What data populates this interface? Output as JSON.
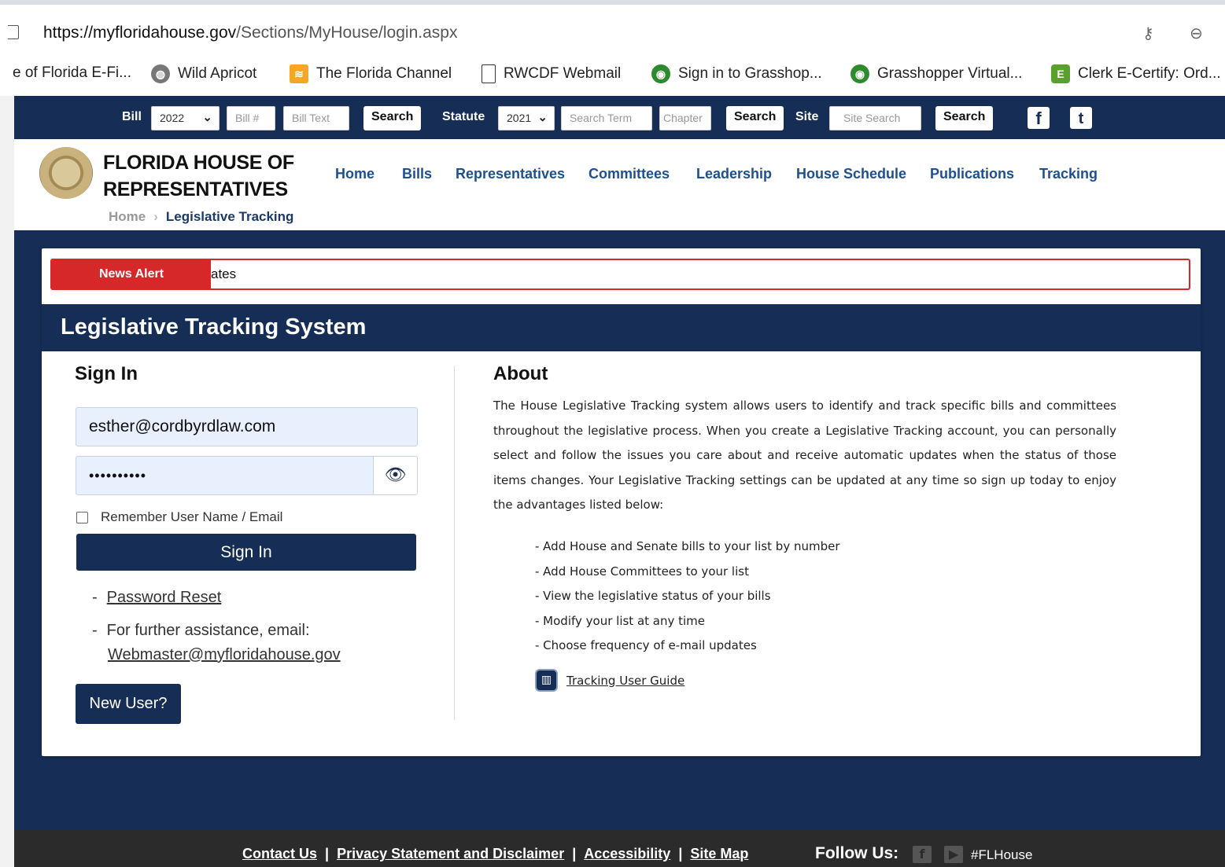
{
  "browser": {
    "url_host": "https://myfloridahouse.gov",
    "url_path": "/Sections/MyHouse/login.aspx",
    "bookmarks": [
      {
        "label": "e of Florida E-Fi...",
        "icon": "none"
      },
      {
        "label": "Wild Apricot",
        "icon": "globe-icon"
      },
      {
        "label": "The Florida Channel",
        "icon": "florida-channel-icon"
      },
      {
        "label": "RWCDF Webmail",
        "icon": "document-icon"
      },
      {
        "label": "Sign in to Grasshop...",
        "icon": "grasshopper-icon"
      },
      {
        "label": "Grasshopper Virtual...",
        "icon": "grasshopper-icon"
      },
      {
        "label": "Clerk E-Certify: Ord...",
        "icon": "clerk-icon"
      }
    ]
  },
  "searchbar": {
    "bill_label": "Bill",
    "bill_year": "2022",
    "bill_num_placeholder": "Bill #",
    "bill_text_placeholder": "Bill Text",
    "search1": "Search",
    "statute_label": "Statute",
    "statute_year": "2021",
    "search_term_placeholder": "Search Term",
    "chapter_placeholder": "Chapter",
    "search2": "Search",
    "site_label": "Site",
    "site_search_placeholder": "Site Search",
    "search3": "Search",
    "facebook": "f",
    "twitter": "t"
  },
  "header": {
    "brand_line1": "FLORIDA HOUSE OF",
    "brand_line2": "REPRESENTATIVES",
    "nav": [
      "Home",
      "Bills",
      "Representatives",
      "Committees",
      "Leadership",
      "House Schedule",
      "Publications",
      "Tracking"
    ],
    "breadcrumb_home": "Home",
    "breadcrumb_sep": "›",
    "breadcrumb_current": "Legislative Tracking"
  },
  "alert": {
    "tag": "News Alert",
    "message": "ates"
  },
  "panel": {
    "title": "Legislative Tracking System"
  },
  "signin": {
    "heading": "Sign In",
    "email_value": "esther@cordbyrdlaw.com",
    "password_value": "••••••••••",
    "remember_label": "Remember User Name / Email",
    "button": "Sign In",
    "password_reset": "Password Reset",
    "assist_text": "For further assistance, email:",
    "assist_email": "Webmaster@myfloridahouse.gov",
    "new_user": "New User?"
  },
  "about": {
    "heading": "About",
    "paragraph": "The House Legislative Tracking system allows users to identify and track specific bills and committees throughout the legislative process. When you create a Legislative Tracking account, you can personally select and follow the issues you care about and receive automatic updates when the status of those items changes. Your Legislative Tracking settings can be updated at any time so sign up today to enjoy the advantages listed below:",
    "advantages": [
      "- Add House and Senate bills to your list by number",
      "- Add House Committees to your list",
      "- View the legislative status of your bills",
      "- Modify your list at any time",
      "- Choose frequency of e-mail updates"
    ],
    "guide_link": "Tracking User Guide"
  },
  "footer": {
    "links": [
      "Contact Us",
      "Privacy Statement and Disclaimer",
      "Accessibility",
      "Site Map"
    ],
    "follow": "Follow Us:",
    "hashtag": "#FLHouse"
  },
  "colors": {
    "navy": "#162e55",
    "link_blue": "#1d4f91",
    "alert_red": "#d62828",
    "footer_bg": "#2b2b2b"
  }
}
